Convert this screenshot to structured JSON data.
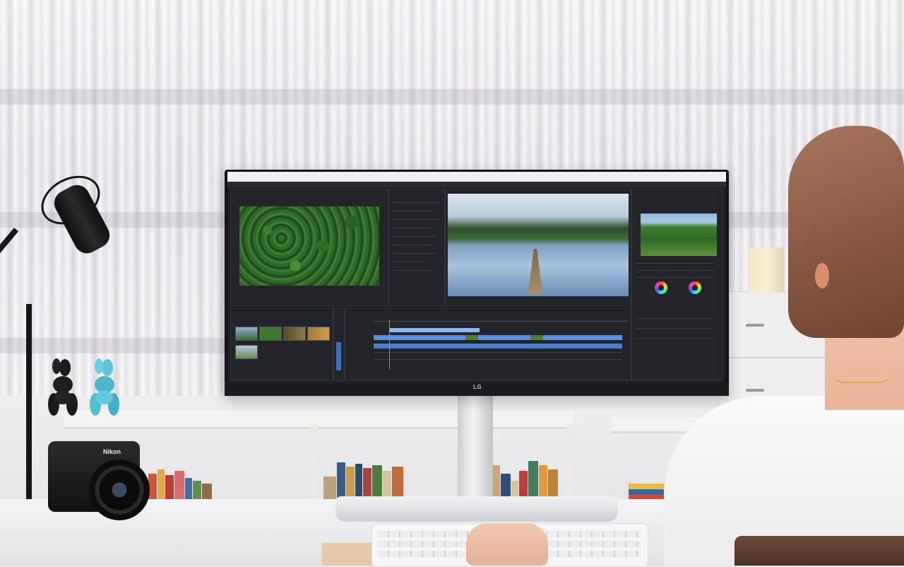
{
  "scene": {
    "description_tags": [
      "monitor-logo",
      "camera-brand"
    ],
    "monitor_logo": "LG",
    "camera_brand": "Nikon"
  },
  "colors": {
    "monitor_bezel": "#141417",
    "screen_bg": "#1c1d22",
    "timeline_clip": "#5d8fd6",
    "curtain": "#eceaee"
  }
}
